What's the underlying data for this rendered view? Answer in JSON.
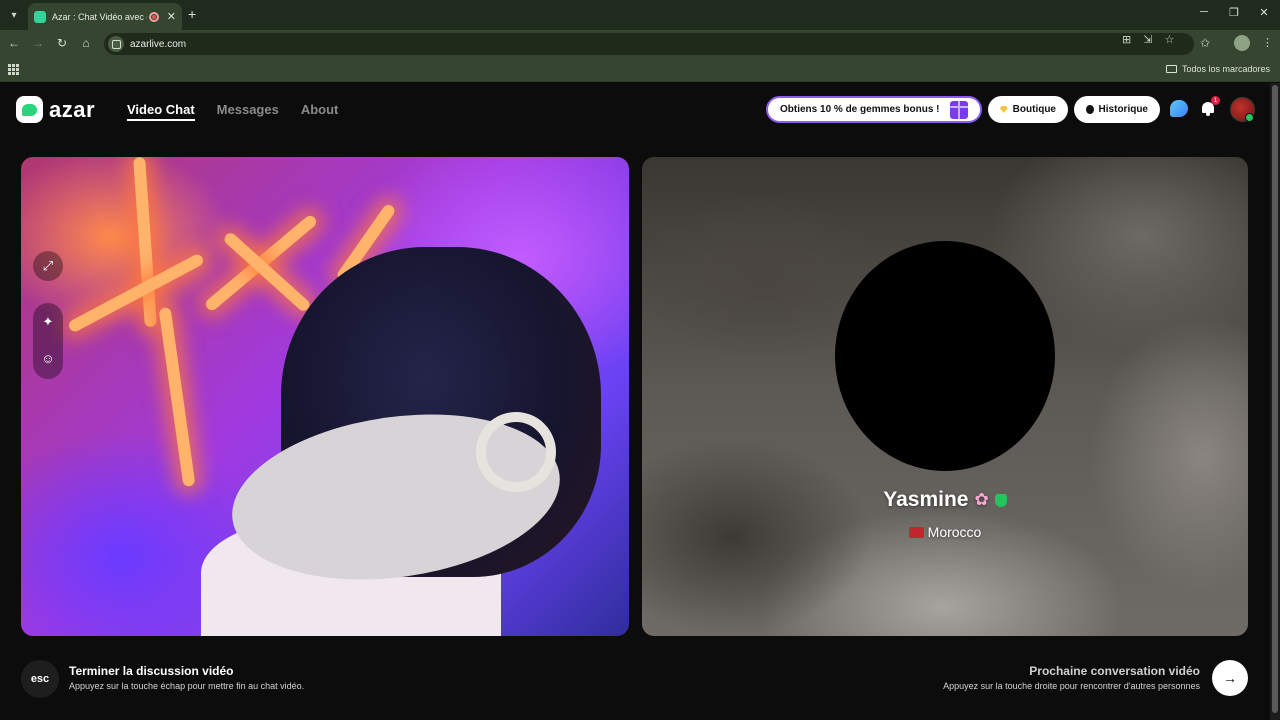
{
  "browser": {
    "tab_title": "Azar : Chat Vidéo avec de n",
    "url": "azarlive.com",
    "bookmarks_all": "Todos los marcadores"
  },
  "app": {
    "logo_text": "azar",
    "nav": [
      {
        "label": "Video Chat",
        "active": true
      },
      {
        "label": "Messages",
        "active": false
      },
      {
        "label": "About",
        "active": false
      }
    ],
    "promo_label": "Obtiens 10 % de gemmes bonus !",
    "boutique_label": "Boutique",
    "history_label": "Historique",
    "notification_count": "1"
  },
  "remote": {
    "name": "Yasmine",
    "country": "Morocco"
  },
  "controls": {
    "esc_key": "esc",
    "end_title": "Terminer la discussion vidéo",
    "end_sub": "Appuyez sur la touche échap pour mettre fin au chat vidéo.",
    "next_title": "Prochaine conversation vidéo",
    "next_sub": "Appuyez sur la touche droite pour rencontrer d'autres personnes"
  },
  "icons": {
    "accent_green": "#2ad47c",
    "promo_border": "#8b5cf6"
  }
}
